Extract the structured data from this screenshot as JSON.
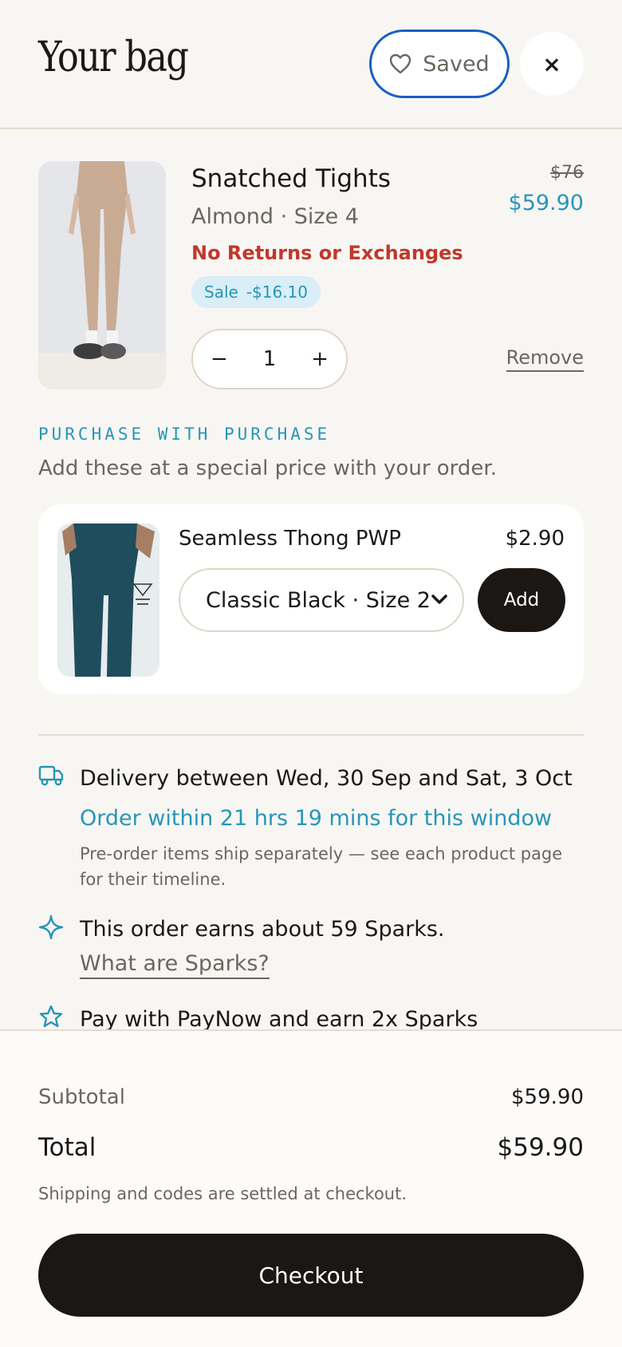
{
  "header": {
    "title": "Your bag",
    "saved_label": "Saved",
    "close_symbol": "×"
  },
  "cart_item": {
    "name": "Snatched Tights",
    "variant": "Almond · Size 4",
    "warning": "No Returns or Exchanges",
    "sale_label": "Sale",
    "sale_amount": "-$16.10",
    "original_price": "$76",
    "sale_price": "$59.90",
    "quantity": "1",
    "minus_symbol": "−",
    "plus_symbol": "+",
    "remove_label": "Remove"
  },
  "pwp": {
    "heading": "PURCHASE WITH PURCHASE",
    "subheading": "Add these at a special price with your order.",
    "product": {
      "name": "Seamless Thong PWP",
      "price": "$2.90",
      "selected_option": "Classic Black · Size 2",
      "add_label": "Add"
    }
  },
  "info": {
    "delivery_prefix": "Delivery between ",
    "delivery_start": "Wed, 30 Sep",
    "delivery_and": " and ",
    "delivery_end": "Sat, 3 Oct",
    "order_within": "Order within 21 hrs 19 mins for this window",
    "preorder_note": "Pre-order items ship separately — see each product page for their timeline.",
    "sparks_text": "This order earns about 59 Sparks.",
    "sparks_link": "What are Sparks?",
    "paynow_prefix": "Pay with ",
    "paynow_method": "PayNow",
    "paynow_middle": " and earn ",
    "paynow_reward": "2x Sparks"
  },
  "summary": {
    "subtotal_label": "Subtotal",
    "subtotal_value": "$59.90",
    "total_label": "Total",
    "total_value": "$59.90",
    "shipping_note": "Shipping and codes are settled at checkout.",
    "checkout_label": "Checkout"
  },
  "icons": {
    "saved": "heart-icon",
    "close": "close-icon",
    "select": "chevron-down-icon",
    "delivery": "truck-icon",
    "sparks": "sparkle-icon",
    "paynow": "star-icon"
  },
  "colors": {
    "accent": "#2796b8",
    "warning": "#c0392b",
    "dark_button": "#1b1715",
    "focus_ring": "#1a5fc2",
    "background": "#f8f6f3"
  }
}
